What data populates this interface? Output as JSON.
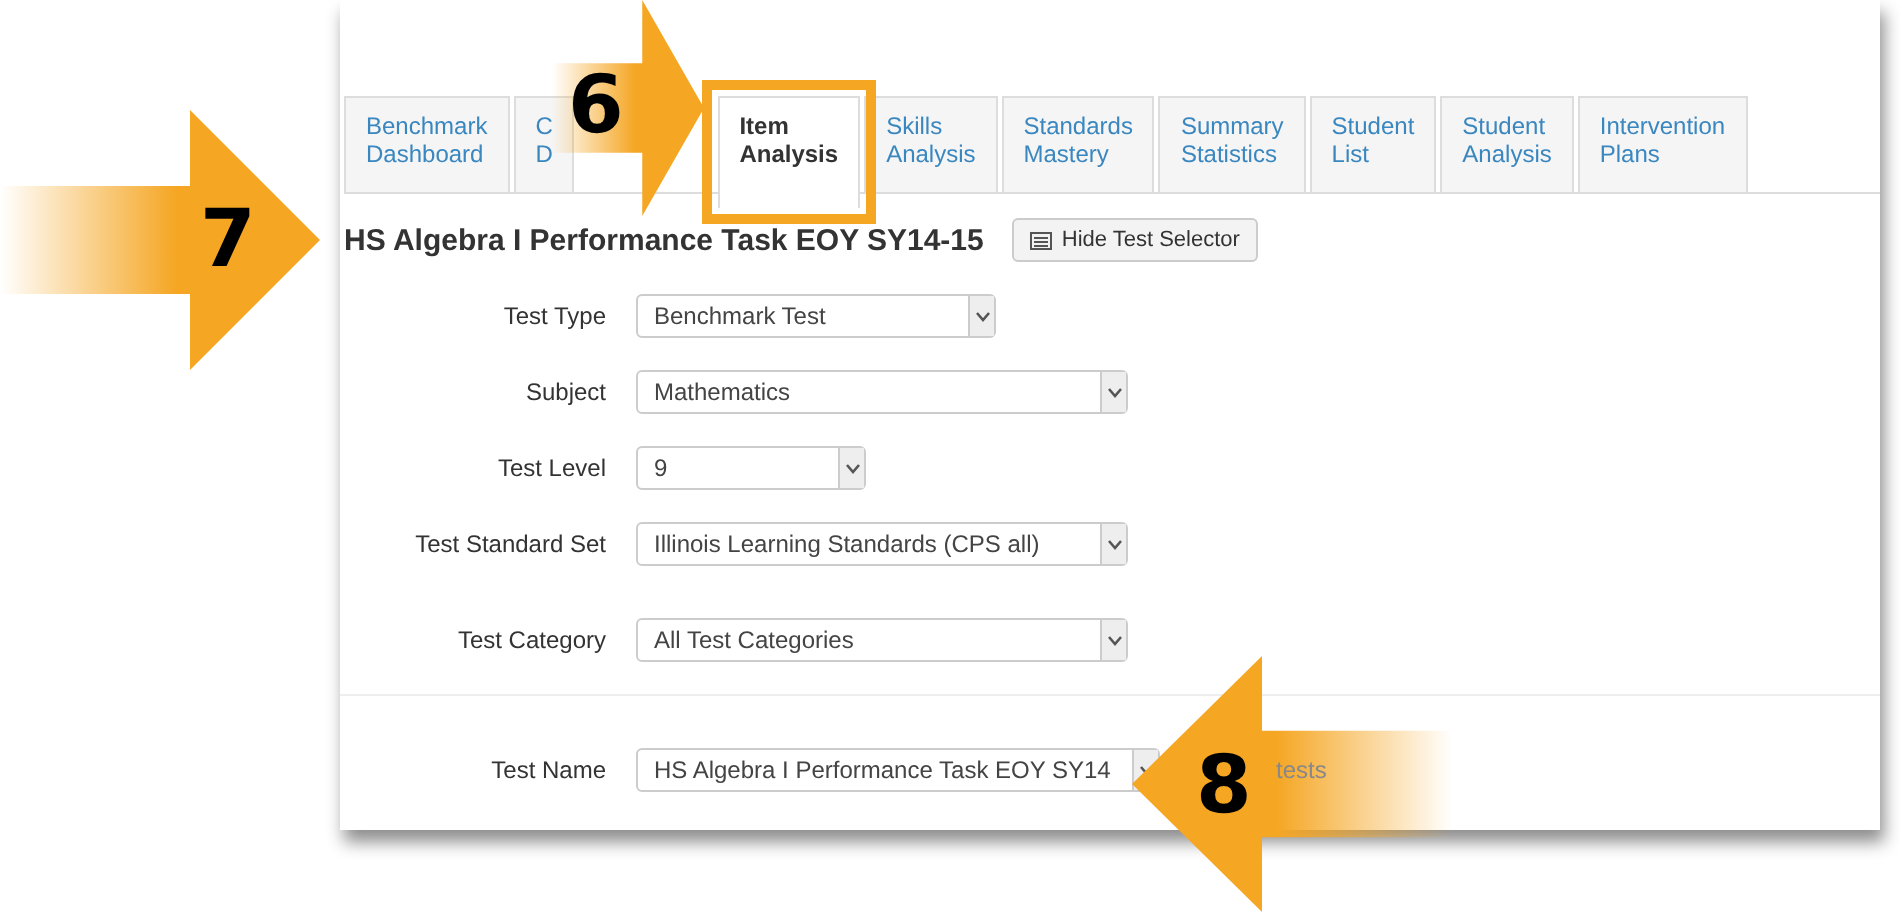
{
  "tabs": [
    {
      "lines": [
        "Benchmark",
        "Dashboard"
      ],
      "selected": false,
      "highlighted": false
    },
    {
      "lines": [
        "C",
        "D"
      ],
      "selected": false,
      "highlighted": false
    },
    {
      "lines": [
        "Item",
        "Analysis"
      ],
      "selected": true,
      "highlighted": true
    },
    {
      "lines": [
        "Skills",
        "Analysis"
      ],
      "selected": false,
      "highlighted": false
    },
    {
      "lines": [
        "Standards",
        "Mastery"
      ],
      "selected": false,
      "highlighted": false
    },
    {
      "lines": [
        "Summary",
        "Statistics"
      ],
      "selected": false,
      "highlighted": false
    },
    {
      "lines": [
        "Student",
        "List"
      ],
      "selected": false,
      "highlighted": false
    },
    {
      "lines": [
        "Student",
        "Analysis"
      ],
      "selected": false,
      "highlighted": false
    },
    {
      "lines": [
        "Intervention",
        "Plans"
      ],
      "selected": false,
      "highlighted": false
    }
  ],
  "heading": {
    "title": "HS Algebra I Performance Task EOY SY14-15",
    "button": "Hide Test Selector"
  },
  "fields": [
    {
      "label": "Test Type",
      "value": "Benchmark Test"
    },
    {
      "label": "Subject",
      "value": "Mathematics"
    },
    {
      "label": "Test Level",
      "value": "9"
    },
    {
      "label": "Test Standard Set",
      "value": "Illinois Learning Standards (CPS all)"
    },
    {
      "label": "Test Category",
      "value": "All Test Categories"
    },
    {
      "label": "Test Name",
      "value": "HS Algebra I Performance Task EOY SY14",
      "note": "tests"
    }
  ],
  "callouts": [
    {
      "number": "7"
    },
    {
      "number": "6"
    },
    {
      "number": "8"
    }
  ]
}
